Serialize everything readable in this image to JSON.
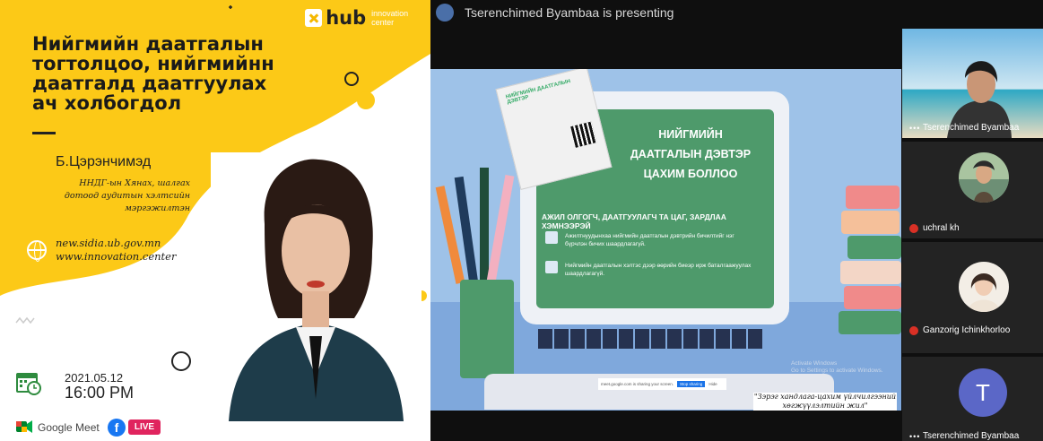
{
  "poster": {
    "title": "Нийгмийн даатгалын тогтолцоо, нийгмийнн даатгалд даатгуулах ач холбогдол",
    "brand": {
      "name": "hub",
      "tagline": "innovation center"
    },
    "speaker_name": "Б.Цэрэнчимэд",
    "speaker_role": "ННДГ-ын Хянах, шалгах дотоод аудитын хэлтсийн мэргэжилтэн",
    "websites": [
      "new.sidia.ub.gov.mn",
      "www.innovation.center"
    ],
    "date": "2021.05.12",
    "time": "16:00 PM",
    "platform_label": "Google Meet",
    "facebook_glyph": "f",
    "live_label": "LIVE"
  },
  "meeting": {
    "presenter_text": "Tserenchimed Byambaa is presenting",
    "slide": {
      "title_line1": "НИЙГМИЙН",
      "title_line2": "ДААТГАЛЫН ДЭВТЭР",
      "title_line3": "ЦАХИМ БОЛЛОО",
      "subtitle": "АЖИЛ ОЛГОГЧ, ДААТГУУЛАГЧ ТА ЦАГ, ЗАРДЛАА ХЭМНЭЭРЭЙ",
      "item1": "Ажилтнуудынхаа нийгмийн даатгалын дэвтрийн бичилтийг нэг бүрчлэн бичих шаардлагагүй.",
      "item2": "Нийгмийн даатгалын хэлтэс дээр өөрийн биеэр ирж баталгаажуулах шаардлагагүй.",
      "card_title": "НИЙГМИЙН ДААТГАЛЫН ДЭВТЭР",
      "share_text": "meet.google.com is sharing your screen.",
      "stop_sharing": "Stop sharing",
      "hide": "Hide",
      "activate": "Activate Windows",
      "activate_sub": "Go to Settings to activate Windows.",
      "quote": "\"Зэрэг хандлага-цахим үйлчилгээний хөгжүүлэлтийн жил\""
    },
    "participants": [
      {
        "name": "Tserenchimed Byambaa",
        "muted": false
      },
      {
        "name": "uchral kh",
        "muted": true
      },
      {
        "name": "Ganzorig Ichinkhorloo",
        "muted": true
      },
      {
        "name": "Tserenchimed Byambaa",
        "muted": false,
        "initial": "T"
      }
    ]
  },
  "colors": {
    "poster_yellow": "#fcc917",
    "slide_green": "#4e9a6b",
    "slide_bg": "#9ec2e8",
    "meet_bg": "#0f0f0f",
    "avatar_purple": "#5b67c7"
  }
}
